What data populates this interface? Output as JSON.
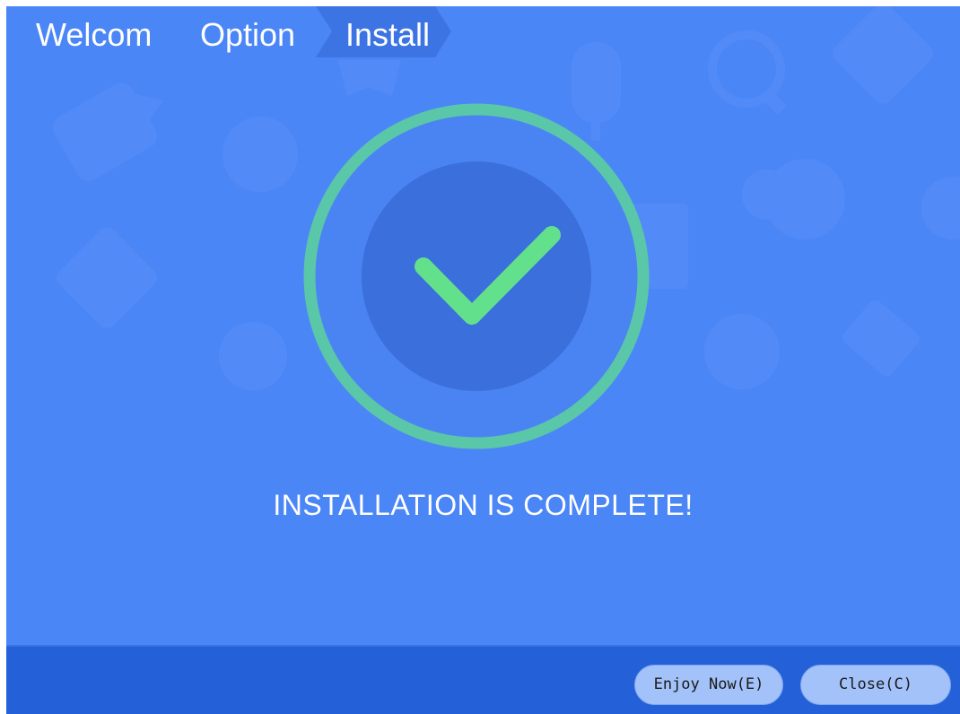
{
  "steps": [
    {
      "label": "Welcom",
      "active": false
    },
    {
      "label": "Option",
      "active": false
    },
    {
      "label": "Install",
      "active": true
    }
  ],
  "status": {
    "message": "INSTALLATION IS COMPLETE!",
    "icon": "checkmark-icon"
  },
  "buttons": {
    "enjoy_now": "Enjoy Now(E)",
    "close": "Close(C)"
  },
  "colors": {
    "background": "#4b86f7",
    "footer": "#2460d8",
    "ring": "#5ac7a8",
    "inner_circle": "#3a6fdc",
    "checkmark": "#63e08c",
    "active_step": "#3d74e4",
    "button": "#a3c2f9"
  }
}
